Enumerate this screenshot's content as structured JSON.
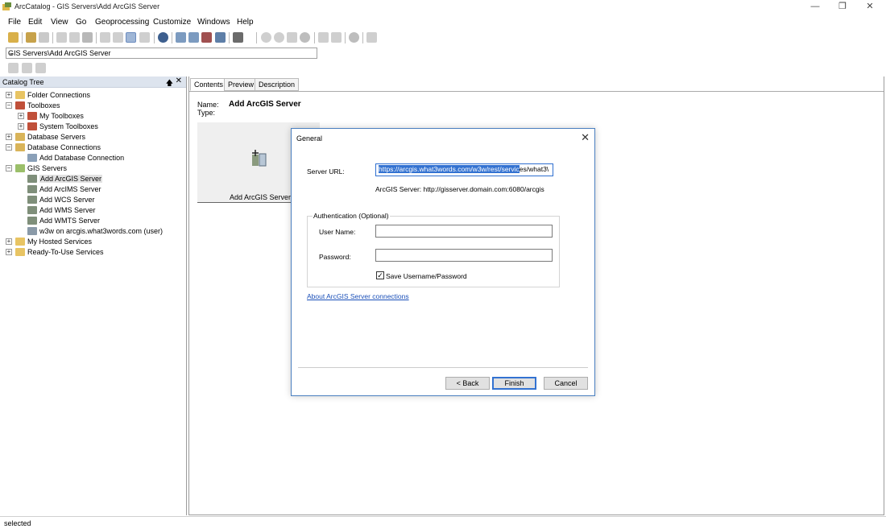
{
  "window": {
    "title": "ArcCatalog - GIS Servers\\Add ArcGIS Server",
    "minimize": "—",
    "restore": "❐",
    "close": "✕"
  },
  "menu": [
    "File",
    "Edit",
    "View",
    "Go",
    "Geoprocessing",
    "Customize",
    "Windows",
    "Help"
  ],
  "location": {
    "value": "GIS Servers\\Add ArcGIS Server",
    "dropdown_glyph": "⌄"
  },
  "catalog": {
    "title": "Catalog Tree",
    "pin_glyph": "🡅",
    "close_glyph": "✕",
    "items": [
      {
        "label": "Folder Connections",
        "expander": "+",
        "icon_color": "#e8c463"
      },
      {
        "label": "Toolboxes",
        "expander": "−",
        "icon_color": "#c0503a"
      },
      {
        "label": "My Toolboxes",
        "expander": "+",
        "icon_color": "#c0503a"
      },
      {
        "label": "System Toolboxes",
        "expander": "+",
        "icon_color": "#c0503a"
      },
      {
        "label": "Database Servers",
        "expander": "+",
        "icon_color": "#d9b45a"
      },
      {
        "label": "Database Connections",
        "expander": "−",
        "icon_color": "#d9b45a"
      },
      {
        "label": "Add Database Connection",
        "expander": "",
        "icon_color": "#8aa0b8"
      },
      {
        "label": "GIS Servers",
        "expander": "−",
        "icon_color": "#9bbf6a"
      },
      {
        "label": "Add ArcGIS Server",
        "expander": "",
        "icon_color": "#7f8f7a"
      },
      {
        "label": "Add ArcIMS Server",
        "expander": "",
        "icon_color": "#7f8f7a"
      },
      {
        "label": "Add WCS Server",
        "expander": "",
        "icon_color": "#7f8f7a"
      },
      {
        "label": "Add WMS Server",
        "expander": "",
        "icon_color": "#7f8f7a"
      },
      {
        "label": "Add WMTS Server",
        "expander": "",
        "icon_color": "#7f8f7a"
      },
      {
        "label": "w3w on arcgis.what3words.com (user)",
        "expander": "",
        "icon_color": "#8a9aa8"
      },
      {
        "label": "My Hosted Services",
        "expander": "+",
        "icon_color": "#e8c463"
      },
      {
        "label": "Ready-To-Use Services",
        "expander": "+",
        "icon_color": "#e8c463"
      }
    ]
  },
  "tabs": [
    "Contents",
    "Preview",
    "Description"
  ],
  "contents": {
    "name_label": "Name:",
    "name_value": "Add ArcGIS Server",
    "type_label": "Type:",
    "thumbnail_caption": "Add ArcGIS Server"
  },
  "dialog": {
    "title": "General",
    "close_glyph": "✕",
    "server_url_label": "Server URL:",
    "server_url_selected": "https://arcgis.what3words.com/w3w/rest/servic",
    "server_url_rest": "es/what3\\",
    "example": "ArcGIS Server: http://gisserver.domain.com:6080/arcgis",
    "auth_legend": "Authentication (Optional)",
    "username_label": "User Name:",
    "username_value": "",
    "password_label": "Password:",
    "password_value": "",
    "save_label": "Save Username/Password",
    "save_checked": true,
    "check_glyph": "✓",
    "about_link": "About ArcGIS Server connections",
    "back_button": "< Back",
    "finish_button": "Finish",
    "cancel_button": "Cancel"
  },
  "status": {
    "text": "selected"
  }
}
